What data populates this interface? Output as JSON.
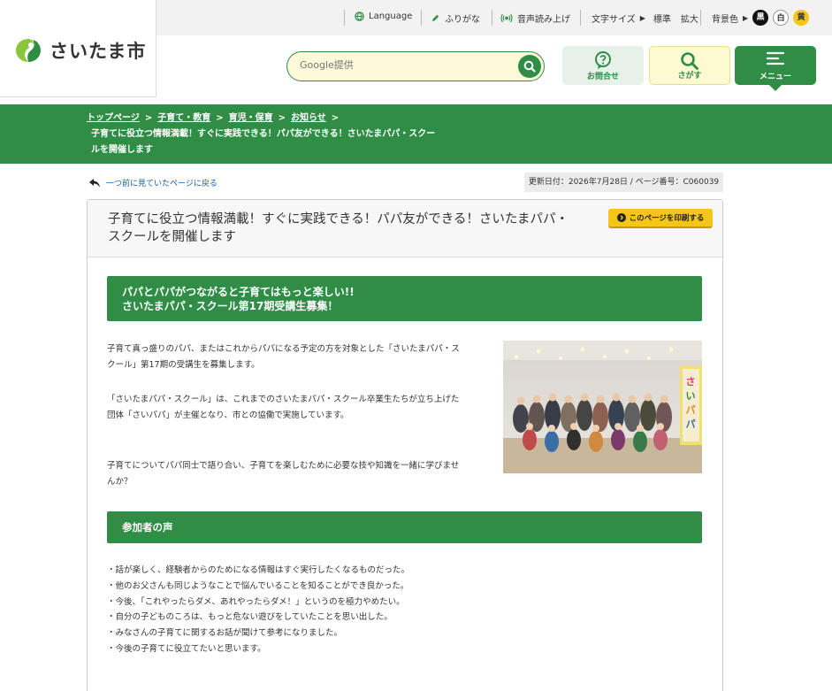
{
  "header": {
    "logo_text": "さいたま市",
    "language": "Language",
    "furigana": "ふりがな",
    "voice": "音声読み上げ",
    "font_size_label": "文字サイズ",
    "font_standard": "標準",
    "font_large": "拡大",
    "bg_color_label": "背景色",
    "bg_black": "黒",
    "bg_white": "白",
    "bg_yellow": "黄",
    "search_placeholder": "Google提供",
    "inquiry_label": "お問合せ",
    "find_label": "さがす",
    "menu_label": "メニュー"
  },
  "breadcrumb": {
    "items": [
      "トップページ",
      "子育て・教育",
      "育児・保育",
      "お知らせ"
    ],
    "current_line1": "子育てに役立つ情報満載！すぐに実践できる！パパ友ができる！さいたまパパ・スクー",
    "current_line2": "ルを開催します"
  },
  "nav": {
    "back_label": "一つ前に見ていたページに戻る",
    "updated": "更新日付：2026年7月28日 / ページ番号：C060039"
  },
  "article": {
    "title_line1": "子育てに役立つ情報満載！すぐに実践できる！パパ友ができる！さいたまパパ・",
    "title_line2": "スクールを開催します",
    "print_label": "このページを印刷する",
    "banner_line1": "パパとパパがつながると子育てはもっと楽しい!!",
    "banner_line2": "さいたまパパ・スクール第17期受講生募集！",
    "p1_line1": "子育て真っ盛りのパパ、またはこれからパパになる予定の方を対象とした「さいたまパパ・ス",
    "p1_line2": "クール」第17期の受講生を募集します。",
    "p2_line1": "「さいたまパパ・スクール」は、これまでのさいたまパパ・スクール卒業生たちが立ち上げた",
    "p2_line2": "団体「さいパパ」が主催となり、市との協働で実施しています。",
    "p3_line1": "子育てについてパパ同士で語り合い、子育てを楽しむために必要な技や知識を一緒に学びませ",
    "p3_line2": "んか？",
    "voices_heading": "参加者の声",
    "voices": [
      "・話が楽しく、経験者からのためになる情報はすぐ実行したくなるものだった。",
      "・他のお父さんも同じようなことで悩んでいることを知ることができ良かった。",
      "・今後、「これやったらダメ、あれやったらダメ！」というのを極力やめたい。",
      "・自分の子どものころは、もっと危ない遊びをしていたことを思い出した。",
      "・みなさんの子育てに関するお話が聞けて参考になりました。",
      "・今後の子育てに役立てたいと思います。"
    ],
    "photo_banner_text": "さいパパ"
  },
  "colors": {
    "brand_green": "#2f8d46",
    "print_yellow": "#f5c518",
    "search_bg": "#fdf9d9"
  }
}
